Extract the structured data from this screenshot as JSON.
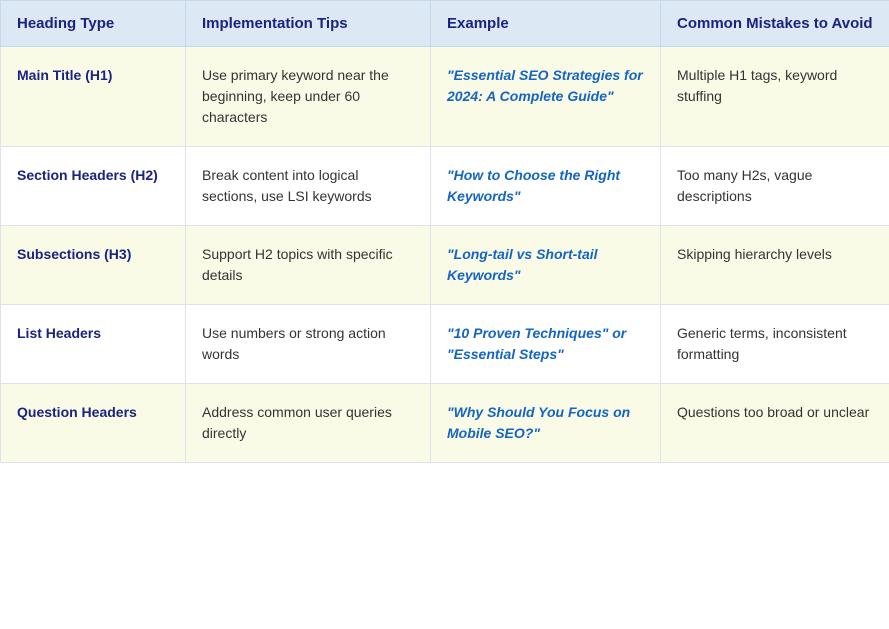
{
  "table": {
    "headers": {
      "col1": "Heading Type",
      "col2": "Implementation Tips",
      "col3": "Example",
      "col4": "Common Mistakes to Avoid"
    },
    "rows": [
      {
        "heading_type": "Main Title (H1)",
        "implementation_tips": "Use primary keyword near the beginning, keep under 60 characters",
        "example": "\"Essential SEO Strategies for 2024: A Complete Guide\"",
        "mistakes": "Multiple H1 tags, keyword stuffing"
      },
      {
        "heading_type": "Section Headers (H2)",
        "implementation_tips": "Break content into logical sections, use LSI keywords",
        "example": "\"How to Choose the Right Keywords\"",
        "mistakes": "Too many H2s, vague descriptions"
      },
      {
        "heading_type": "Subsections (H3)",
        "implementation_tips": "Support H2 topics with specific details",
        "example": "\"Long-tail vs Short-tail Keywords\"",
        "mistakes": "Skipping hierarchy levels"
      },
      {
        "heading_type": "List Headers",
        "implementation_tips": "Use numbers or strong action words",
        "example": "\"10 Proven Techniques\" or \"Essential Steps\"",
        "mistakes": "Generic terms, inconsistent formatting"
      },
      {
        "heading_type": "Question Headers",
        "implementation_tips": "Address common user queries directly",
        "example": "\"Why Should You Focus on Mobile SEO?\"",
        "mistakes": "Questions too broad or unclear"
      }
    ]
  }
}
